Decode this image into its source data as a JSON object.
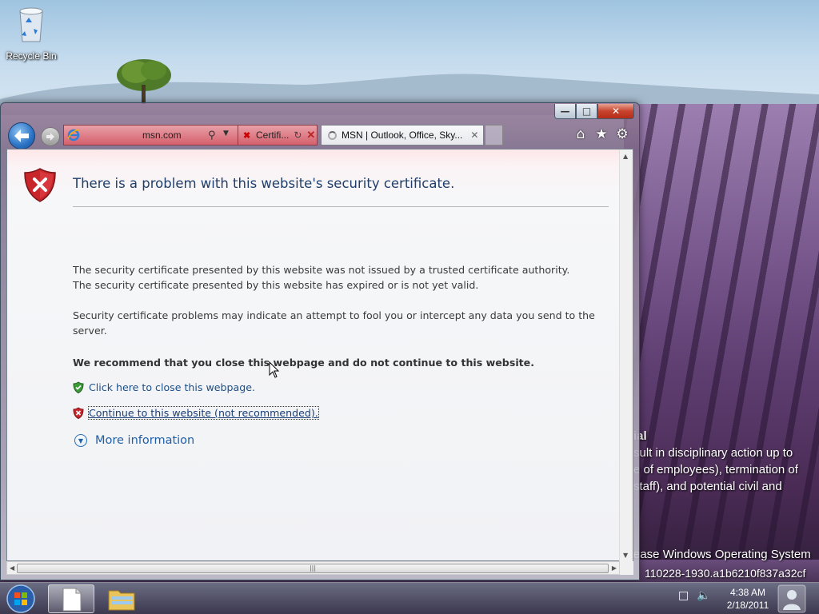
{
  "desktop": {
    "recycle_bin_label": "Recycle Bin",
    "watermark": {
      "line1": "ial",
      "line2": "sult in disciplinary action up to",
      "line3": "e of employees), termination of",
      "line4": "staff), and potential civil and",
      "line5": "ease Windows Operating System",
      "line6": "110228-1930.a1b6210f837a32cf"
    }
  },
  "browser": {
    "address_url": "msn.com",
    "tabs": [
      {
        "label": "Certifi...",
        "state": "error"
      },
      {
        "label": "MSN | Outlook, Office, Sky...",
        "state": "loading"
      }
    ],
    "colors": {
      "address_bar": "#d5606c",
      "back_button": "#2b72c4"
    }
  },
  "page": {
    "title": "There is a problem with this website's security certificate.",
    "para1_line1": "The security certificate presented by this website was not issued by a trusted certificate authority.",
    "para1_line2": "The security certificate presented by this website has expired or is not yet valid.",
    "para2_line1": "Security certificate problems may indicate an attempt to fool you or intercept any data you send to the",
    "para2_line2": "server.",
    "recommendation": "We recommend that you close this webpage and do not continue to this website.",
    "close_link": "Click here to close this webpage.",
    "continue_link": "Continue to this website (not recommended).",
    "more_info": "More information"
  },
  "taskbar": {
    "time": "4:38 AM",
    "date": "2/18/2011"
  }
}
